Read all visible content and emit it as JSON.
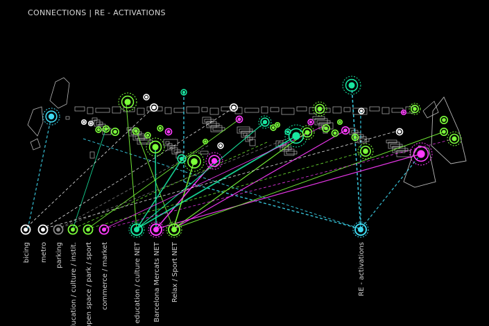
{
  "title": "CONNECTIONS | RE - ACTIVATIONS",
  "colors": {
    "background": "#000000",
    "green": "#7CFF3A",
    "teal": "#18E6A0",
    "magenta": "#FF3CFF",
    "cyan": "#3ED8F0",
    "white": "#FFFFFF",
    "grey": "#8A8A8A",
    "outline": "#B8B8B8"
  },
  "legend": [
    {
      "label": "bicing",
      "color": "white",
      "style": "ring"
    },
    {
      "label": "metro",
      "color": "white",
      "style": "ring"
    },
    {
      "label": "parking",
      "color": "grey",
      "style": "ring"
    },
    {
      "label": "education / culture / instit.",
      "color": "green",
      "style": "ring"
    },
    {
      "label": "open space / park / sport",
      "color": "green",
      "style": "ring"
    },
    {
      "label": "commerce / market",
      "color": "magenta",
      "style": "ring"
    },
    {
      "label": "education / culture NET",
      "color": "teal",
      "style": "net"
    },
    {
      "label": "Barcelona Mercats NET",
      "color": "magenta",
      "style": "net"
    },
    {
      "label": "Relax / Sport NET",
      "color": "green",
      "style": "net"
    },
    {
      "label": "RE - activations",
      "color": "cyan",
      "style": "net"
    }
  ]
}
